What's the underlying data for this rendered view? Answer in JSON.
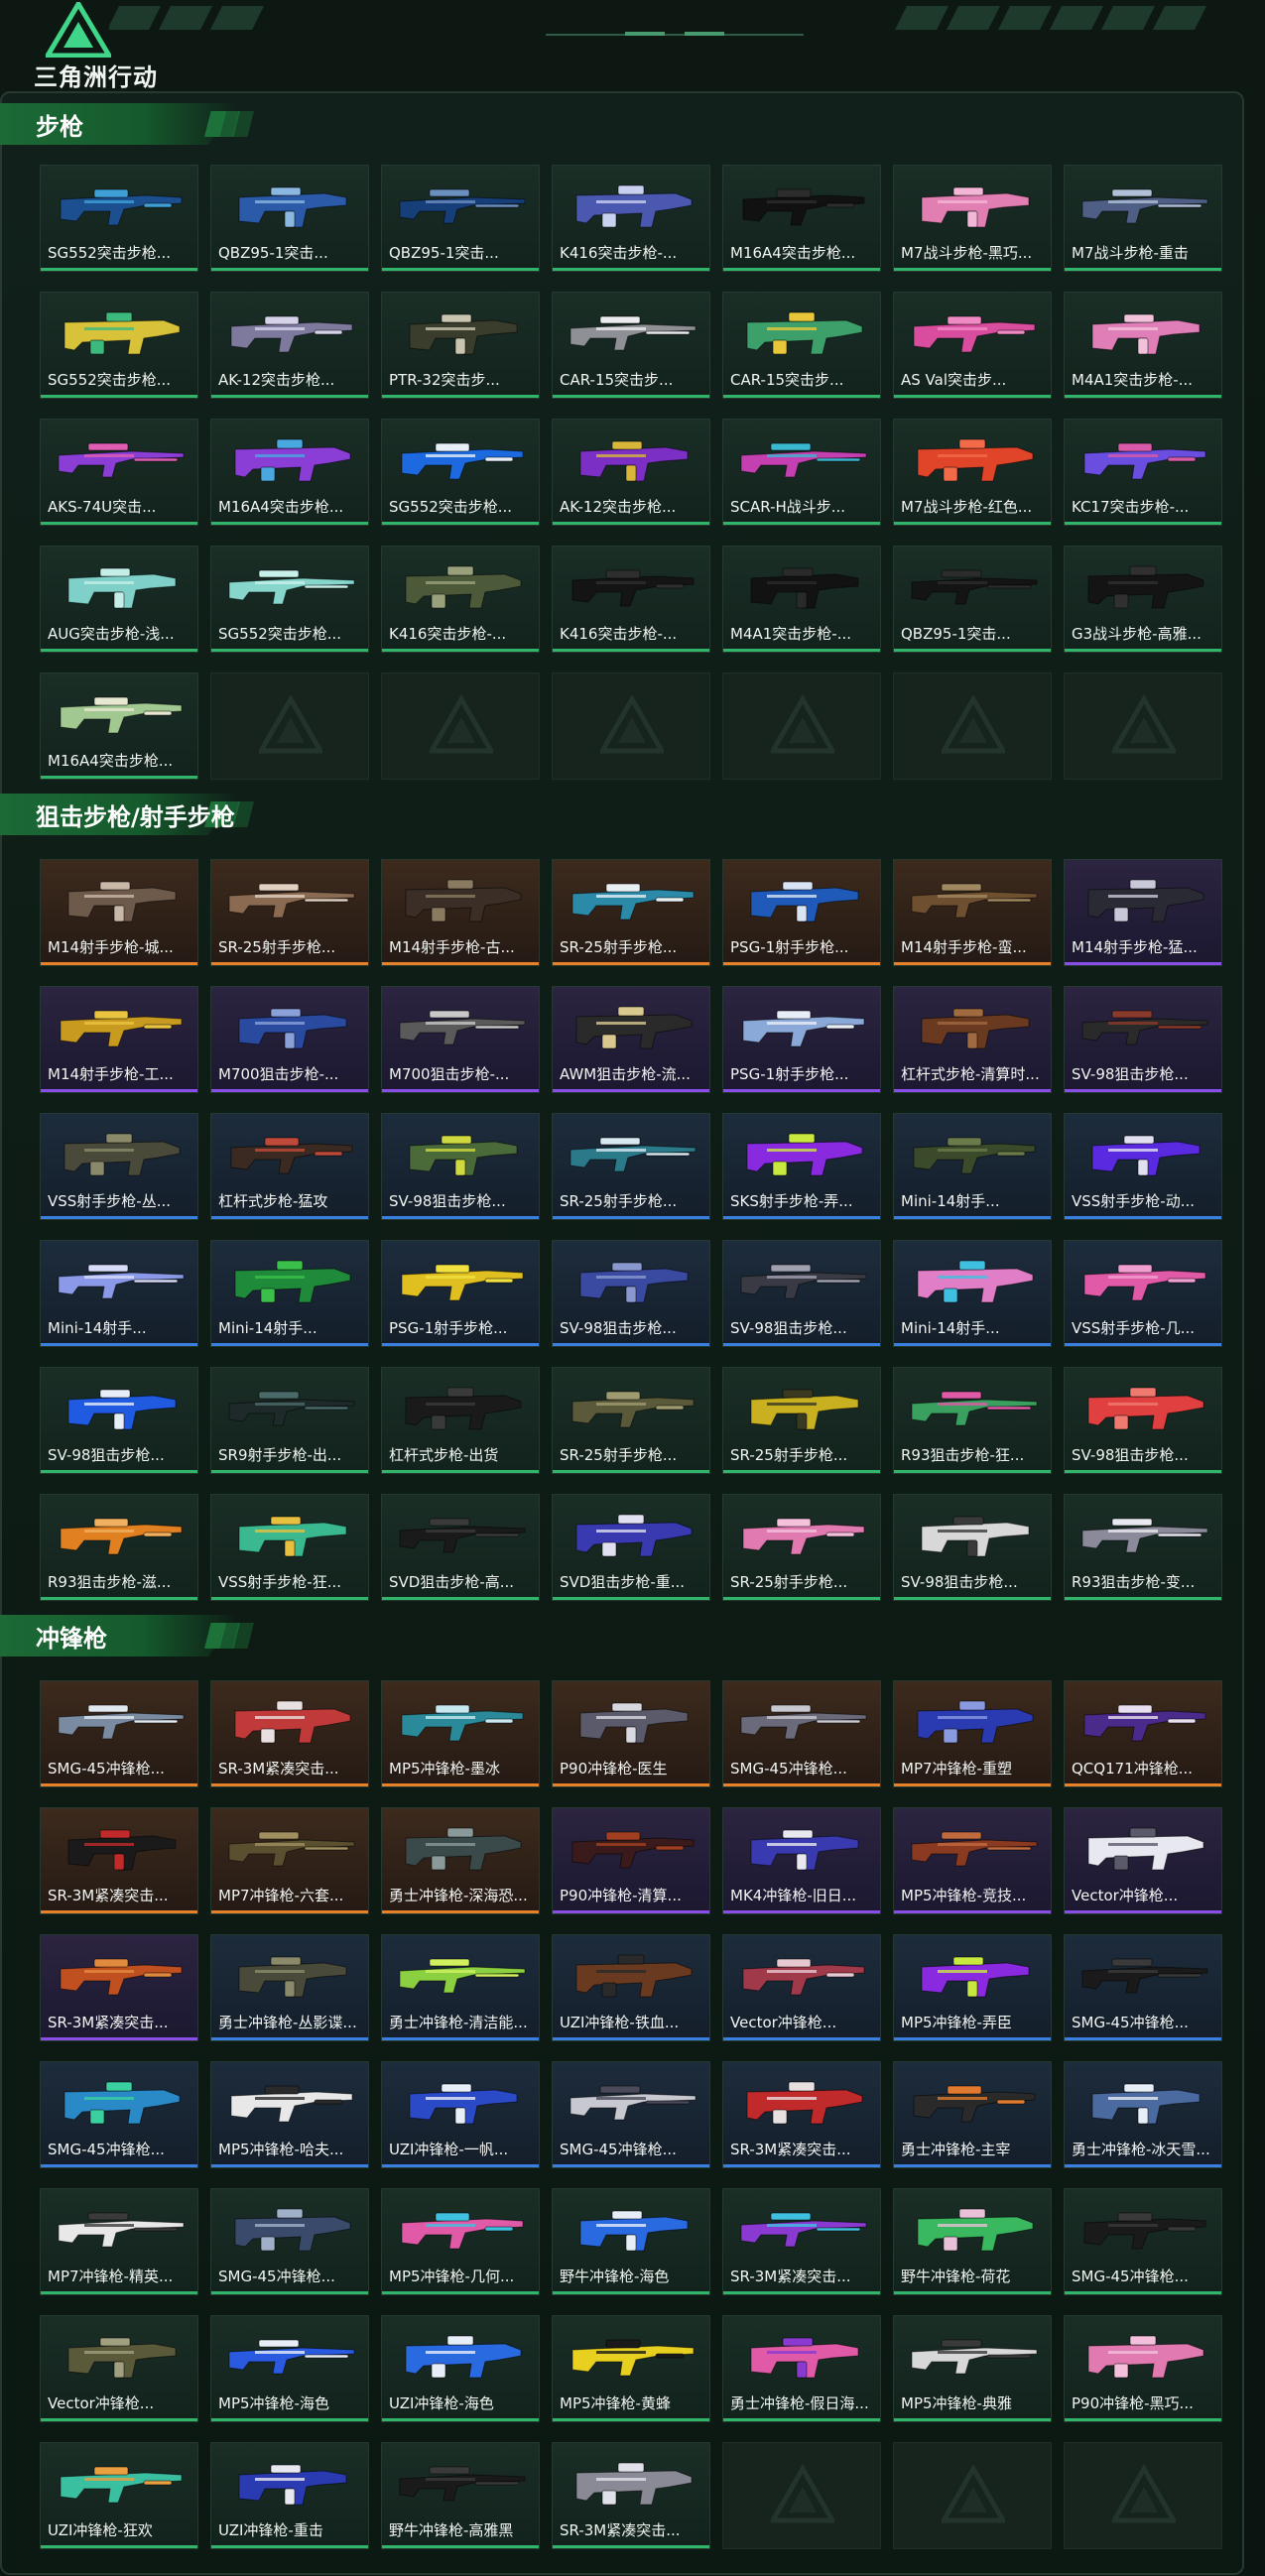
{
  "app": {
    "logo_text": "三角洲行动"
  },
  "sections": [
    {
      "title": "步枪",
      "items": [
        {
          "name": "SG552突击步枪...",
          "rarity": "green",
          "colors": [
            "#1c4f8f",
            "#3fa0d6"
          ]
        },
        {
          "name": "QBZ95-1突击...",
          "rarity": "green",
          "colors": [
            "#2b5aa8",
            "#8ab8e0"
          ]
        },
        {
          "name": "QBZ95-1突击...",
          "rarity": "green",
          "colors": [
            "#163f7a",
            "#6b8fbf"
          ]
        },
        {
          "name": "K416突击步枪-...",
          "rarity": "green",
          "colors": [
            "#4a58b0",
            "#c9d1f0"
          ]
        },
        {
          "name": "M16A4突击步枪...",
          "rarity": "green",
          "colors": [
            "#111111",
            "#2d2d2d"
          ]
        },
        {
          "name": "M7战斗步枪-黑巧...",
          "rarity": "green",
          "colors": [
            "#e27fb2",
            "#f4b6d6"
          ]
        },
        {
          "name": "M7战斗步枪-重击",
          "rarity": "green",
          "colors": [
            "#4e5e84",
            "#b0c0d8"
          ]
        },
        {
          "name": "SG552突击步枪...",
          "rarity": "green",
          "colors": [
            "#d7c23a",
            "#3db97e"
          ]
        },
        {
          "name": "AK-12突击步枪...",
          "rarity": "green",
          "colors": [
            "#7e7a9e",
            "#d6d2ea"
          ]
        },
        {
          "name": "PTR-32突击步...",
          "rarity": "green",
          "colors": [
            "#3a3d2c",
            "#c8c4b0"
          ]
        },
        {
          "name": "CAR-15突击步...",
          "rarity": "green",
          "colors": [
            "#8f8f96",
            "#ececf0"
          ]
        },
        {
          "name": "CAR-15突击步...",
          "rarity": "green",
          "colors": [
            "#3da06a",
            "#e8c83a"
          ]
        },
        {
          "name": "AS Val突击步...",
          "rarity": "green",
          "colors": [
            "#d94d9e",
            "#f08ac4"
          ]
        },
        {
          "name": "M4A1突击步枪-...",
          "rarity": "green",
          "colors": [
            "#e07eb8",
            "#f2c2da"
          ]
        },
        {
          "name": "AKS-74U突击...",
          "rarity": "green",
          "colors": [
            "#8a3ed6",
            "#e05db4"
          ]
        },
        {
          "name": "M16A4突击步枪...",
          "rarity": "green",
          "colors": [
            "#8a3ed6",
            "#4aa8e0"
          ]
        },
        {
          "name": "SG552突击步枪...",
          "rarity": "green",
          "colors": [
            "#1d6ae0",
            "#e8eef8"
          ]
        },
        {
          "name": "AK-12突击步枪...",
          "rarity": "green",
          "colors": [
            "#7c2fc4",
            "#d8b63a"
          ]
        },
        {
          "name": "SCAR-H战斗步...",
          "rarity": "green",
          "colors": [
            "#c43fb0",
            "#3ab8d0"
          ]
        },
        {
          "name": "M7战斗步枪-红色...",
          "rarity": "green",
          "colors": [
            "#e0452a",
            "#f26a48"
          ]
        },
        {
          "name": "KC17突击步枪-...",
          "rarity": "green",
          "colors": [
            "#6a4ee0",
            "#d85aa8"
          ]
        },
        {
          "name": "AUG突击步枪-浅...",
          "rarity": "green",
          "colors": [
            "#7fd0c8",
            "#c4eee8"
          ]
        },
        {
          "name": "SG552突击步枪...",
          "rarity": "green",
          "colors": [
            "#86d6cc",
            "#c8f0ea"
          ]
        },
        {
          "name": "K416突击步枪-...",
          "rarity": "green",
          "colors": [
            "#4d5a3a",
            "#9aa07c"
          ]
        },
        {
          "name": "K416突击步枪-...",
          "rarity": "green",
          "colors": [
            "#141414",
            "#2e2e2e"
          ]
        },
        {
          "name": "M4A1突击步枪-...",
          "rarity": "green",
          "colors": [
            "#121212",
            "#2a2a2a"
          ]
        },
        {
          "name": "QBZ95-1突击...",
          "rarity": "green",
          "colors": [
            "#141414",
            "#2c2c2c"
          ]
        },
        {
          "name": "G3战斗步枪-高雅...",
          "rarity": "green",
          "colors": [
            "#141414",
            "#303030"
          ]
        },
        {
          "name": "M16A4突击步枪...",
          "rarity": "green",
          "colors": [
            "#a0c890",
            "#e8e8d0"
          ]
        }
      ],
      "empty_slots": 6
    },
    {
      "title": "狙击步枪/射手步枪",
      "items": [
        {
          "name": "M14射手步枪-城...",
          "rarity": "orange",
          "colors": [
            "#6e5a4a",
            "#c8b8a8"
          ]
        },
        {
          "name": "SR-25射手步枪...",
          "rarity": "orange",
          "colors": [
            "#8a6a50",
            "#e0d0c0"
          ]
        },
        {
          "name": "M14射手步枪-古...",
          "rarity": "orange",
          "colors": [
            "#3a2e26",
            "#8a7a60"
          ]
        },
        {
          "name": "SR-25射手步枪...",
          "rarity": "orange",
          "colors": [
            "#2a8aa8",
            "#e8f0f4"
          ]
        },
        {
          "name": "PSG-1射手步枪...",
          "rarity": "orange",
          "colors": [
            "#1f5ab8",
            "#d8e4f4"
          ]
        },
        {
          "name": "M14射手步枪-蛮...",
          "rarity": "orange",
          "colors": [
            "#6e5030",
            "#a08860"
          ]
        },
        {
          "name": "M14射手步枪-猛...",
          "rarity": "purple",
          "colors": [
            "#2a2a34",
            "#c8c8d8"
          ]
        },
        {
          "name": "M14射手步枪-工...",
          "rarity": "purple",
          "colors": [
            "#c89a20",
            "#e8c440"
          ]
        },
        {
          "name": "M700狙击步枪-...",
          "rarity": "purple",
          "colors": [
            "#2a4aa0",
            "#8aa0d8"
          ]
        },
        {
          "name": "M700狙击步枪-...",
          "rarity": "purple",
          "colors": [
            "#5a5a5a",
            "#c8c8c8"
          ]
        },
        {
          "name": "AWM狙击步枪-流...",
          "rarity": "purple",
          "colors": [
            "#2a2a2a",
            "#d8c890"
          ]
        },
        {
          "name": "PSG-1射手步枪...",
          "rarity": "purple",
          "colors": [
            "#8aa8d8",
            "#e8eef8"
          ]
        },
        {
          "name": "杠杆式步枪-清算时...",
          "rarity": "purple",
          "colors": [
            "#6a3a20",
            "#a06a40"
          ]
        },
        {
          "name": "SV-98狙击步枪...",
          "rarity": "purple",
          "colors": [
            "#2a2a2a",
            "#8a3a2a"
          ]
        },
        {
          "name": "VSS射手步枪-丛...",
          "rarity": "blue",
          "colors": [
            "#4a4a3a",
            "#8a8a6a"
          ]
        },
        {
          "name": "杠杆式步枪-猛攻",
          "rarity": "blue",
          "colors": [
            "#3a2a22",
            "#c04a3a"
          ]
        },
        {
          "name": "SV-98狙击步枪...",
          "rarity": "blue",
          "colors": [
            "#4a6a3a",
            "#d0d840"
          ]
        },
        {
          "name": "SR-25射手步枪...",
          "rarity": "blue",
          "colors": [
            "#2a7a8a",
            "#d8e8f0"
          ]
        },
        {
          "name": "SKS射手步枪-弄...",
          "rarity": "blue",
          "colors": [
            "#8a2ae0",
            "#c8e840"
          ]
        },
        {
          "name": "Mini-14射手...",
          "rarity": "blue",
          "colors": [
            "#3a4a2a",
            "#6a7a4a"
          ]
        },
        {
          "name": "VSS射手步枪-动...",
          "rarity": "blue",
          "colors": [
            "#5a2ae0",
            "#e0e0f0"
          ]
        },
        {
          "name": "Mini-14射手...",
          "rarity": "blue",
          "colors": [
            "#8a9ae8",
            "#d8dcf8"
          ]
        },
        {
          "name": "Mini-14射手...",
          "rarity": "blue",
          "colors": [
            "#1f8a3a",
            "#3ac04a"
          ]
        },
        {
          "name": "PSG-1射手步枪...",
          "rarity": "blue",
          "colors": [
            "#e0c020",
            "#f0e040"
          ]
        },
        {
          "name": "SV-98狙击步枪...",
          "rarity": "blue",
          "colors": [
            "#3a4aa0",
            "#8a98d0"
          ]
        },
        {
          "name": "SV-98狙击步枪...",
          "rarity": "blue",
          "colors": [
            "#3a3a44",
            "#a0a0b0"
          ]
        },
        {
          "name": "Mini-14射手...",
          "rarity": "blue",
          "colors": [
            "#e07ec8",
            "#40c0e0"
          ]
        },
        {
          "name": "VSS射手步枪-几...",
          "rarity": "blue",
          "colors": [
            "#e05aa8",
            "#f0a0d0"
          ]
        },
        {
          "name": "SV-98狙击步枪...",
          "rarity": "green",
          "colors": [
            "#1f5ae0",
            "#e8eef8"
          ]
        },
        {
          "name": "SR9射手步枪-出...",
          "rarity": "green",
          "colors": [
            "#1e2a2a",
            "#4a6a6a"
          ]
        },
        {
          "name": "杠杆式步枪-出货",
          "rarity": "green",
          "colors": [
            "#1a1a1a",
            "#3a3a3a"
          ]
        },
        {
          "name": "SR-25射手步枪...",
          "rarity": "green",
          "colors": [
            "#5a5a3a",
            "#a09a70"
          ]
        },
        {
          "name": "SR-25射手步枪...",
          "rarity": "green",
          "colors": [
            "#c8b020",
            "#3a3a20"
          ]
        },
        {
          "name": "R93狙击步枪-狂...",
          "rarity": "green",
          "colors": [
            "#3aa060",
            "#e05aa8"
          ]
        },
        {
          "name": "SV-98狙击步枪...",
          "rarity": "green",
          "colors": [
            "#e04040",
            "#f07a70"
          ]
        },
        {
          "name": "R93狙击步枪-滋...",
          "rarity": "green",
          "colors": [
            "#e08020",
            "#f0b060"
          ]
        },
        {
          "name": "VSS射手步枪-狂...",
          "rarity": "green",
          "colors": [
            "#3ab890",
            "#e8c040"
          ]
        },
        {
          "name": "SVD狙击步枪-高...",
          "rarity": "green",
          "colors": [
            "#1a1a1a",
            "#3a3a3a"
          ]
        },
        {
          "name": "SVD狙击步枪-重...",
          "rarity": "green",
          "colors": [
            "#3a3ab0",
            "#e0e0f0"
          ]
        },
        {
          "name": "SR-25射手步枪...",
          "rarity": "green",
          "colors": [
            "#e07ab0",
            "#f4c0dc"
          ]
        },
        {
          "name": "SV-98狙击步枪...",
          "rarity": "green",
          "colors": [
            "#d8d8d8",
            "#3a3a3a"
          ]
        },
        {
          "name": "R93狙击步枪-变...",
          "rarity": "green",
          "colors": [
            "#8a8a9a",
            "#e8e8f0"
          ]
        }
      ],
      "empty_slots": 0
    },
    {
      "title": "冲锋枪",
      "items": [
        {
          "name": "SMG-45冲锋枪...",
          "rarity": "orange",
          "colors": [
            "#7a8aa0",
            "#e0e8f0"
          ]
        },
        {
          "name": "SR-3M紧凑突击...",
          "rarity": "orange",
          "colors": [
            "#c03a3a",
            "#e8e0e0"
          ]
        },
        {
          "name": "MP5冲锋枪-墨冰",
          "rarity": "orange",
          "colors": [
            "#2a8a9a",
            "#c8e8f0"
          ]
        },
        {
          "name": "P90冲锋枪-医生",
          "rarity": "orange",
          "colors": [
            "#5a5a6a",
            "#d8d8e0"
          ]
        },
        {
          "name": "SMG-45冲锋枪...",
          "rarity": "orange",
          "colors": [
            "#6a6a7a",
            "#c8c8d0"
          ]
        },
        {
          "name": "MP7冲锋枪-重塑",
          "rarity": "orange",
          "colors": [
            "#2a3ab0",
            "#8a9ae0"
          ]
        },
        {
          "name": "QCQ171冲锋枪...",
          "rarity": "orange",
          "colors": [
            "#4a2a8a",
            "#e8e0f0"
          ]
        },
        {
          "name": "SR-3M紧凑突击...",
          "rarity": "orange",
          "colors": [
            "#1a1a1a",
            "#c02a2a"
          ]
        },
        {
          "name": "MP7冲锋枪-六套...",
          "rarity": "orange",
          "colors": [
            "#5a5030",
            "#a09060"
          ]
        },
        {
          "name": "勇士冲锋枪-深海恐...",
          "rarity": "orange",
          "colors": [
            "#3a4a4a",
            "#8a9a9a"
          ]
        },
        {
          "name": "P90冲锋枪-清算...",
          "rarity": "purple",
          "colors": [
            "#3a1a1a",
            "#a04020"
          ]
        },
        {
          "name": "MK4冲锋枪-旧日...",
          "rarity": "purple",
          "colors": [
            "#3a3ab0",
            "#e8e8f0"
          ]
        },
        {
          "name": "MP5冲锋枪-竞技...",
          "rarity": "purple",
          "colors": [
            "#8a3a20",
            "#c06a40"
          ]
        },
        {
          "name": "Vector冲锋枪...",
          "rarity": "purple",
          "colors": [
            "#e8e8f0",
            "#5a5a6a"
          ]
        },
        {
          "name": "SR-3M紧凑突击...",
          "rarity": "purple",
          "colors": [
            "#c05020",
            "#e08a40"
          ]
        },
        {
          "name": "勇士冲锋枪-丛影谍...",
          "rarity": "blue",
          "colors": [
            "#4a4a3a",
            "#8a8a6a"
          ]
        },
        {
          "name": "勇士冲锋枪-清洁能...",
          "rarity": "blue",
          "colors": [
            "#8ad040",
            "#d0f060"
          ]
        },
        {
          "name": "UZI冲锋枪-铁血...",
          "rarity": "blue",
          "colors": [
            "#6a3a20",
            "#2a2a2a"
          ]
        },
        {
          "name": "Vector冲锋枪...",
          "rarity": "blue",
          "colors": [
            "#a03a4a",
            "#e8c8d0"
          ]
        },
        {
          "name": "MP5冲锋枪-弄臣",
          "rarity": "blue",
          "colors": [
            "#8a2ae0",
            "#c8e840"
          ]
        },
        {
          "name": "SMG-45冲锋枪...",
          "rarity": "blue",
          "colors": [
            "#1a1a1a",
            "#3a3a3a"
          ]
        },
        {
          "name": "SMG-45冲锋枪...",
          "rarity": "blue",
          "colors": [
            "#2a8ac8",
            "#3ad0a0"
          ]
        },
        {
          "name": "MP5冲锋枪-哈夫...",
          "rarity": "blue",
          "colors": [
            "#e8e8e8",
            "#2a2a2a"
          ]
        },
        {
          "name": "UZI冲锋枪-一帆...",
          "rarity": "blue",
          "colors": [
            "#2a4ac8",
            "#e8eef8"
          ]
        },
        {
          "name": "SMG-45冲锋枪...",
          "rarity": "blue",
          "colors": [
            "#c8c8d0",
            "#4a4a5a"
          ]
        },
        {
          "name": "SR-3M紧凑突击...",
          "rarity": "blue",
          "colors": [
            "#c02a2a",
            "#e8e0e0"
          ]
        },
        {
          "name": "勇士冲锋枪-主宰",
          "rarity": "blue",
          "colors": [
            "#2a2a2a",
            "#e07a30"
          ]
        },
        {
          "name": "勇士冲锋枪-冰天雪...",
          "rarity": "blue",
          "colors": [
            "#4a6aa0",
            "#e8eef8"
          ]
        },
        {
          "name": "MP7冲锋枪-精英...",
          "rarity": "green",
          "colors": [
            "#e8e8e8",
            "#3a3a3a"
          ]
        },
        {
          "name": "SMG-45冲锋枪...",
          "rarity": "green",
          "colors": [
            "#3a4a6a",
            "#a0b0c8"
          ]
        },
        {
          "name": "MP5冲锋枪-几何...",
          "rarity": "green",
          "colors": [
            "#e05aa8",
            "#40c0e0"
          ]
        },
        {
          "name": "野牛冲锋枪-海色",
          "rarity": "green",
          "colors": [
            "#2a6ae0",
            "#e8eef8"
          ]
        },
        {
          "name": "SR-3M紧凑突击...",
          "rarity": "green",
          "colors": [
            "#8a3ad0",
            "#40c0e0"
          ]
        },
        {
          "name": "野牛冲锋枪-荷花",
          "rarity": "green",
          "colors": [
            "#3ab860",
            "#e8c0d8"
          ]
        },
        {
          "name": "SMG-45冲锋枪...",
          "rarity": "green",
          "colors": [
            "#1a1a1a",
            "#3a3a3a"
          ]
        },
        {
          "name": "Vector冲锋枪...",
          "rarity": "green",
          "colors": [
            "#5a5a3a",
            "#a0a080"
          ]
        },
        {
          "name": "MP5冲锋枪-海色",
          "rarity": "green",
          "colors": [
            "#2a5ae0",
            "#e8eef8"
          ]
        },
        {
          "name": "UZI冲锋枪-海色",
          "rarity": "green",
          "colors": [
            "#2a6ae0",
            "#e8eef8"
          ]
        },
        {
          "name": "MP5冲锋枪-黄蜂",
          "rarity": "green",
          "colors": [
            "#e8d020",
            "#1a1a1a"
          ]
        },
        {
          "name": "勇士冲锋枪-假日海...",
          "rarity": "green",
          "colors": [
            "#e05aa8",
            "#8a3ad0"
          ]
        },
        {
          "name": "MP5冲锋枪-典雅",
          "rarity": "green",
          "colors": [
            "#d8d8d8",
            "#3a3a3a"
          ]
        },
        {
          "name": "P90冲锋枪-黑巧...",
          "rarity": "green",
          "colors": [
            "#e07ab0",
            "#f4c0dc"
          ]
        },
        {
          "name": "UZI冲锋枪-狂欢",
          "rarity": "green",
          "colors": [
            "#3ac0a0",
            "#e8a040"
          ]
        },
        {
          "name": "UZI冲锋枪-重击",
          "rarity": "green",
          "colors": [
            "#2a3ab0",
            "#e8e8f0"
          ]
        },
        {
          "name": "野牛冲锋枪-高雅黑",
          "rarity": "green",
          "colors": [
            "#1a1a1a",
            "#3a3a3a"
          ]
        },
        {
          "name": "SR-3M紧凑突击...",
          "rarity": "green",
          "colors": [
            "#8a8a96",
            "#e0e0e8"
          ]
        }
      ],
      "empty_slots": 3
    }
  ]
}
